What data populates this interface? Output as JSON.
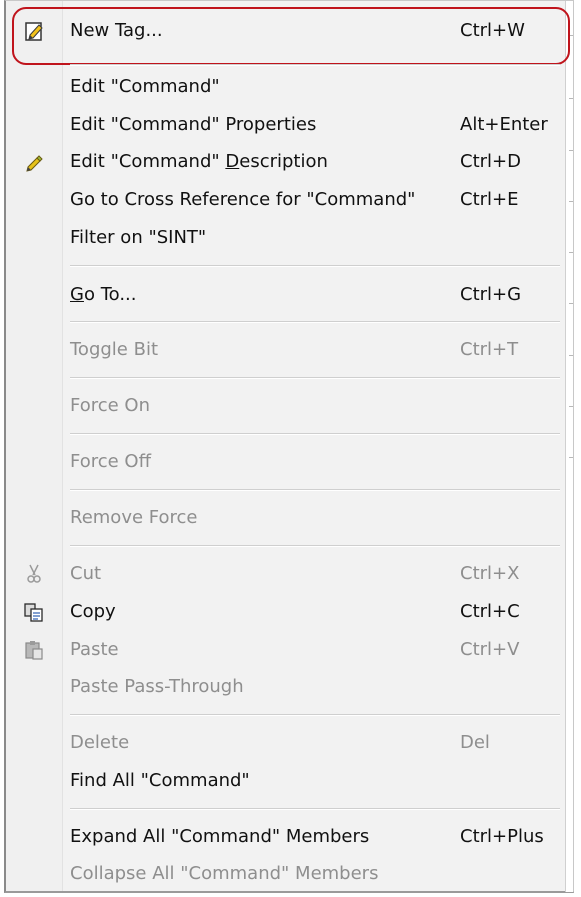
{
  "menu": {
    "items": [
      {
        "label": "New Tag...",
        "shortcut": "Ctrl+W",
        "icon": "new-tag-icon",
        "enabled": true
      },
      {
        "label": "Edit \"Command\"",
        "shortcut": "",
        "enabled": true
      },
      {
        "label": "Edit \"Command\" Properties",
        "shortcut": "Alt+Enter",
        "enabled": true
      },
      {
        "label_pre": "Edit \"Command\" ",
        "label_underlined": "D",
        "label_post": "escription",
        "shortcut": "Ctrl+D",
        "icon": "pencil-icon",
        "enabled": true
      },
      {
        "label": "Go to Cross Reference for \"Command\"",
        "shortcut": "Ctrl+E",
        "enabled": true
      },
      {
        "label": "Filter on \"SINT\"",
        "shortcut": "",
        "enabled": true
      },
      {
        "label_underlined": "G",
        "label_post": "o To...",
        "shortcut": "Ctrl+G",
        "enabled": true
      },
      {
        "label": "Toggle Bit",
        "shortcut": "Ctrl+T",
        "enabled": false
      },
      {
        "label": "Force On",
        "shortcut": "",
        "enabled": false
      },
      {
        "label": "Force Off",
        "shortcut": "",
        "enabled": false
      },
      {
        "label": "Remove Force",
        "shortcut": "",
        "enabled": false
      },
      {
        "label": "Cut",
        "shortcut": "Ctrl+X",
        "icon": "scissors-icon",
        "enabled": false
      },
      {
        "label": "Copy",
        "shortcut": "Ctrl+C",
        "icon": "copy-icon",
        "enabled": true
      },
      {
        "label": "Paste",
        "shortcut": "Ctrl+V",
        "icon": "paste-icon",
        "enabled": false
      },
      {
        "label": "Paste Pass-Through",
        "shortcut": "",
        "enabled": false
      },
      {
        "label": "Delete",
        "shortcut": "Del",
        "enabled": false
      },
      {
        "label": "Find All \"Command\"",
        "shortcut": "",
        "enabled": true
      },
      {
        "label": "Expand All \"Command\" Members",
        "shortcut": "Ctrl+Plus",
        "enabled": true
      },
      {
        "label": "Collapse All \"Command\" Members",
        "shortcut": "",
        "enabled": false
      }
    ]
  },
  "colors": {
    "highlight_ring": "#c0141c",
    "disabled_text": "#8e8e8e",
    "menu_background": "#f2f2f2"
  }
}
